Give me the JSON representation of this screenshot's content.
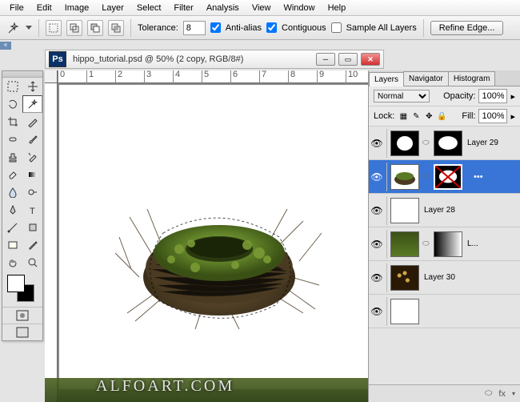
{
  "menu": {
    "items": [
      "File",
      "Edit",
      "Image",
      "Layer",
      "Select",
      "Filter",
      "Analysis",
      "View",
      "Window",
      "Help"
    ]
  },
  "options": {
    "tolerance_label": "Tolerance:",
    "tolerance_value": "8",
    "antialias": "Anti-alias",
    "contiguous": "Contiguous",
    "sample_all": "Sample All Layers",
    "refine": "Refine Edge..."
  },
  "document": {
    "title": "hippo_tutorial.psd @ 50% (2 copy, RGB/8#)"
  },
  "ruler": {
    "marks": [
      "0",
      "1",
      "2",
      "3",
      "4",
      "5",
      "6",
      "7",
      "8",
      "9",
      "10"
    ]
  },
  "panel": {
    "tabs": [
      "Layers",
      "Navigator",
      "Histogram"
    ],
    "blend_mode": "Normal",
    "opacity_label": "Opacity:",
    "opacity_value": "100%",
    "lock_label": "Lock:",
    "fill_label": "Fill:",
    "fill_value": "100%"
  },
  "layers": [
    {
      "name": "Layer 29",
      "mask": true,
      "sel": false,
      "vis": true,
      "thumb": "dark"
    },
    {
      "name": "",
      "mask": true,
      "sel": true,
      "vis": true,
      "thumb": "nest",
      "x": true
    },
    {
      "name": "Layer 28",
      "mask": false,
      "sel": false,
      "vis": true,
      "thumb": "white"
    },
    {
      "name": "L...",
      "mask": true,
      "sel": false,
      "vis": true,
      "thumb": "moss",
      "grad": true
    },
    {
      "name": "Layer 30",
      "mask": false,
      "sel": false,
      "vis": true,
      "thumb": "bokeh"
    },
    {
      "name": "",
      "mask": false,
      "sel": false,
      "vis": true,
      "thumb": "white"
    }
  ],
  "footer": {
    "fx": "fx"
  },
  "watermark": "ALFOART.COM",
  "colors": {
    "accent": "#3875d7",
    "ps": "#0a3268"
  }
}
